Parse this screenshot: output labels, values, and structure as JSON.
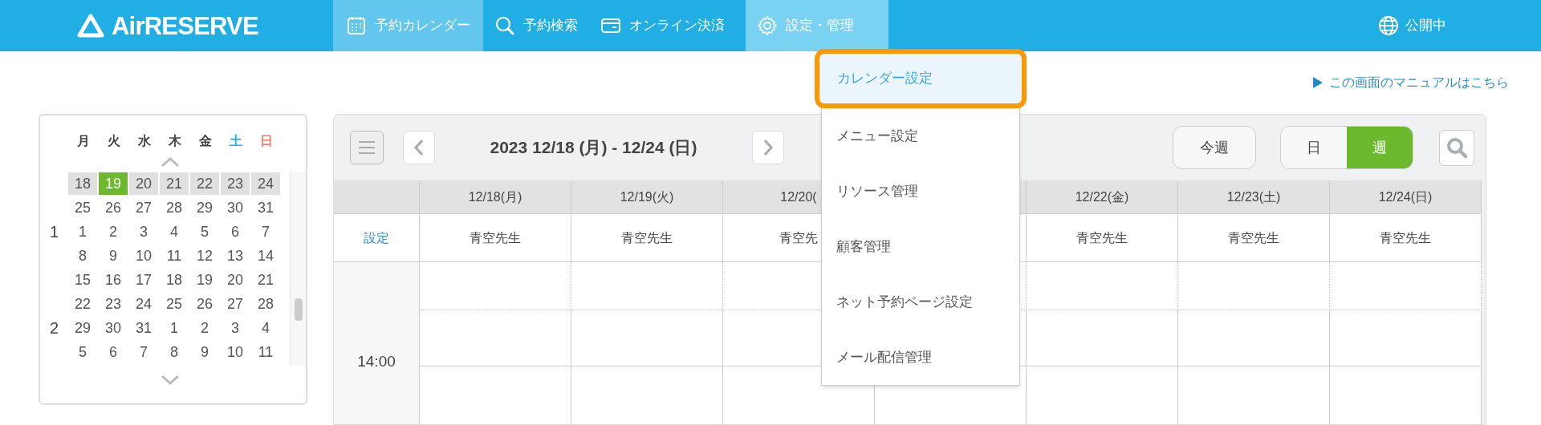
{
  "app": {
    "logo": "AirRESERVE"
  },
  "nav": [
    {
      "label": "予約カレンダー",
      "selected": true,
      "expanded": false
    },
    {
      "label": "予約検索",
      "selected": false,
      "expanded": false
    },
    {
      "label": "オンライン決済",
      "selected": false,
      "expanded": false
    },
    {
      "label": "設定・管理",
      "selected": false,
      "expanded": true
    }
  ],
  "publish_status": "公開中",
  "manual_link": "この画面のマニュアルはこちら",
  "settings_menu": [
    {
      "label": "カレンダー設定",
      "highlighted": true
    },
    {
      "label": "メニュー設定",
      "highlighted": false
    },
    {
      "label": "リソース管理",
      "highlighted": false
    },
    {
      "label": "顧客管理",
      "highlighted": false
    },
    {
      "label": "ネット予約ページ設定",
      "highlighted": false
    },
    {
      "label": "メール配信管理",
      "highlighted": false
    }
  ],
  "mini_calendar": {
    "weekdays": [
      {
        "label": "月",
        "kind": "weekday"
      },
      {
        "label": "火",
        "kind": "weekday"
      },
      {
        "label": "水",
        "kind": "weekday"
      },
      {
        "label": "木",
        "kind": "weekday"
      },
      {
        "label": "金",
        "kind": "weekday"
      },
      {
        "label": "土",
        "kind": "saturday"
      },
      {
        "label": "日",
        "kind": "sunday"
      }
    ],
    "weeks": [
      {
        "current": true,
        "days": [
          {
            "day": "18",
            "selected": false
          },
          {
            "day": "19",
            "selected": true
          },
          {
            "day": "20",
            "selected": false
          },
          {
            "day": "21",
            "selected": false
          },
          {
            "day": "22",
            "selected": false
          },
          {
            "day": "23",
            "selected": false
          },
          {
            "day": "24",
            "selected": false
          }
        ]
      },
      {
        "current": false,
        "days": [
          {
            "day": "25",
            "selected": false
          },
          {
            "day": "26",
            "selected": false
          },
          {
            "day": "27",
            "selected": false
          },
          {
            "day": "28",
            "selected": false
          },
          {
            "day": "29",
            "selected": false
          },
          {
            "day": "30",
            "selected": false
          },
          {
            "day": "31",
            "selected": false
          }
        ]
      },
      {
        "current": false,
        "month": "1",
        "days": [
          {
            "day": "1",
            "selected": false
          },
          {
            "day": "2",
            "selected": false
          },
          {
            "day": "3",
            "selected": false
          },
          {
            "day": "4",
            "selected": false
          },
          {
            "day": "5",
            "selected": false
          },
          {
            "day": "6",
            "selected": false
          },
          {
            "day": "7",
            "selected": false
          }
        ]
      },
      {
        "current": false,
        "days": [
          {
            "day": "8",
            "selected": false
          },
          {
            "day": "9",
            "selected": false
          },
          {
            "day": "10",
            "selected": false
          },
          {
            "day": "11",
            "selected": false
          },
          {
            "day": "12",
            "selected": false
          },
          {
            "day": "13",
            "selected": false
          },
          {
            "day": "14",
            "selected": false
          }
        ]
      },
      {
        "current": false,
        "days": [
          {
            "day": "15",
            "selected": false
          },
          {
            "day": "16",
            "selected": false
          },
          {
            "day": "17",
            "selected": false
          },
          {
            "day": "18",
            "selected": false
          },
          {
            "day": "19",
            "selected": false
          },
          {
            "day": "20",
            "selected": false
          },
          {
            "day": "21",
            "selected": false
          }
        ]
      },
      {
        "current": false,
        "days": [
          {
            "day": "22",
            "selected": false
          },
          {
            "day": "23",
            "selected": false
          },
          {
            "day": "24",
            "selected": false
          },
          {
            "day": "25",
            "selected": false
          },
          {
            "day": "26",
            "selected": false
          },
          {
            "day": "27",
            "selected": false
          },
          {
            "day": "28",
            "selected": false
          }
        ]
      },
      {
        "current": false,
        "month": "2",
        "days": [
          {
            "day": "29",
            "selected": false
          },
          {
            "day": "30",
            "selected": false
          },
          {
            "day": "31",
            "selected": false
          },
          {
            "day": "1",
            "selected": false
          },
          {
            "day": "2",
            "selected": false
          },
          {
            "day": "3",
            "selected": false
          },
          {
            "day": "4",
            "selected": false
          }
        ]
      },
      {
        "current": false,
        "days": [
          {
            "day": "5",
            "selected": false
          },
          {
            "day": "6",
            "selected": false
          },
          {
            "day": "7",
            "selected": false
          },
          {
            "day": "8",
            "selected": false
          },
          {
            "day": "9",
            "selected": false
          },
          {
            "day": "10",
            "selected": false
          },
          {
            "day": "11",
            "selected": false
          }
        ]
      }
    ]
  },
  "calendar": {
    "range_title": "2023 12/18 (月) - 12/24 (日)",
    "this_week_button": "今週",
    "view_toggle": [
      {
        "label": "日",
        "selected": false
      },
      {
        "label": "週",
        "selected": true
      }
    ],
    "settings_link": "設定",
    "columns": [
      {
        "date": "12/18(月)",
        "resource": "青空先生"
      },
      {
        "date": "12/19(火)",
        "resource": "青空先生"
      },
      {
        "date": "12/20(",
        "resource": "青空先"
      },
      {},
      {
        "date": "12/22(金)",
        "resource": "青空先生"
      },
      {
        "date": "12/23(土)",
        "resource": "青空先生"
      },
      {
        "date": "12/24(日)",
        "resource": "青空先生"
      }
    ],
    "time_label": "14:00"
  }
}
